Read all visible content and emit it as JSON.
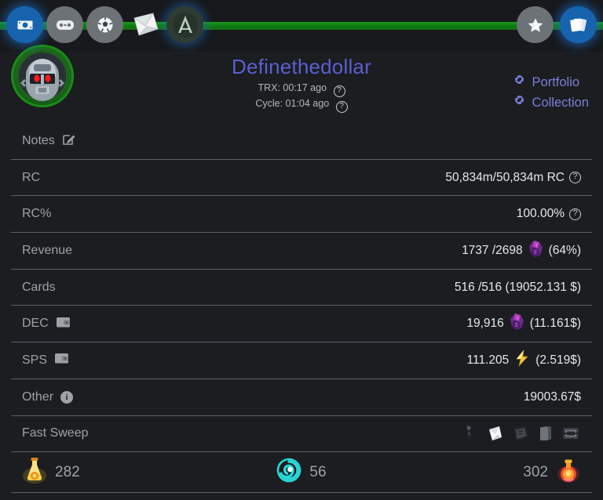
{
  "nav": {
    "left_items": [
      {
        "name": "cash-icon",
        "label": "Cash",
        "active": true
      },
      {
        "name": "gamepad-icon",
        "label": "Battles",
        "active": false
      },
      {
        "name": "soccer-ball-icon",
        "label": "Ball",
        "active": false
      },
      {
        "name": "letter-icon",
        "label": "Letter",
        "active": false
      },
      {
        "name": "archmage-logo-icon",
        "label": "A",
        "active": false
      }
    ],
    "right_items": [
      {
        "name": "star-icon",
        "label": "Favorites",
        "active": false
      },
      {
        "name": "cards-icon",
        "label": "Cards",
        "active": true
      }
    ]
  },
  "header": {
    "username": "Definethedollar",
    "trx_label": "TRX: 00:17 ago",
    "cycle_label": "Cycle: 01:04 ago",
    "help_glyph": "?",
    "links": [
      {
        "label": "Portfolio",
        "name": "portfolio-link"
      },
      {
        "label": "Collection",
        "name": "collection-link"
      }
    ]
  },
  "rows": [
    {
      "key": "notes",
      "label": "Notes",
      "value": ""
    },
    {
      "key": "rc",
      "label": "RC",
      "value": "50,834m/50,834m RC"
    },
    {
      "key": "rcpct",
      "label": "RC%",
      "value": "100.00%"
    },
    {
      "key": "revenue",
      "label": "Revenue",
      "value_main": "1737 /2698",
      "value_suffix": "(64%)"
    },
    {
      "key": "cards",
      "label": "Cards",
      "value": "516 /516 (19052.131 $)"
    },
    {
      "key": "dec",
      "label": "DEC",
      "value_main": "19,916",
      "value_suffix": "(11.161$)"
    },
    {
      "key": "sps",
      "label": "SPS",
      "value_main": "111.205",
      "value_suffix": "(2.519$)"
    },
    {
      "key": "other",
      "label": "Other",
      "value": "19003.67$"
    },
    {
      "key": "sweep",
      "label": "Fast Sweep",
      "value": ""
    }
  ],
  "footer": {
    "left": {
      "value": "282",
      "icon": "gold-potion-icon"
    },
    "center": {
      "value": "56",
      "icon": "energy-spiral-icon"
    },
    "right": {
      "value": "302",
      "icon": "red-potion-icon"
    }
  },
  "colors": {
    "accent_green": "#1a8f1a",
    "username": "#5b5fd0",
    "link": "#7b7fd8",
    "background": "#1b1d20",
    "topbar": "#17191c",
    "divider": "#5b6064",
    "label": "#9ea2a6",
    "value": "#e6e8ea"
  }
}
